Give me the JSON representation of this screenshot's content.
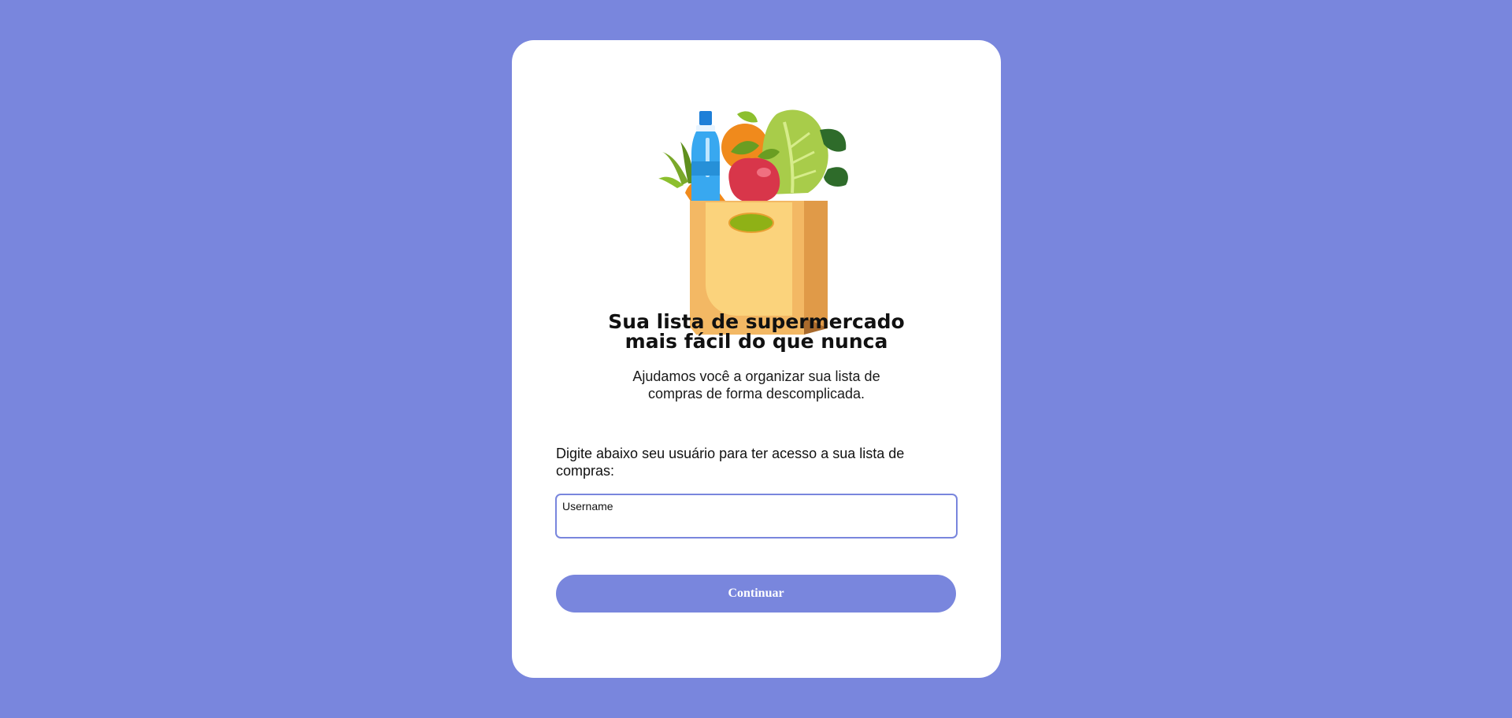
{
  "colors": {
    "background": "#7986dd",
    "card": "#ffffff",
    "accent": "#7986dd",
    "text": "#111111"
  },
  "hero": {
    "icon": "grocery-bag-illustration",
    "title_line1": "Sua lista de supermercado",
    "title_line2": "mais fácil do que nunca",
    "subtitle_line1": "Ajudamos você a organizar sua lista de",
    "subtitle_line2": "compras de forma descomplicada."
  },
  "login": {
    "instruction": "Digite abaixo seu usuário para ter acesso a sua lista de compras:",
    "username_label": "Username",
    "username_value": "",
    "continue_label": "Continuar"
  }
}
